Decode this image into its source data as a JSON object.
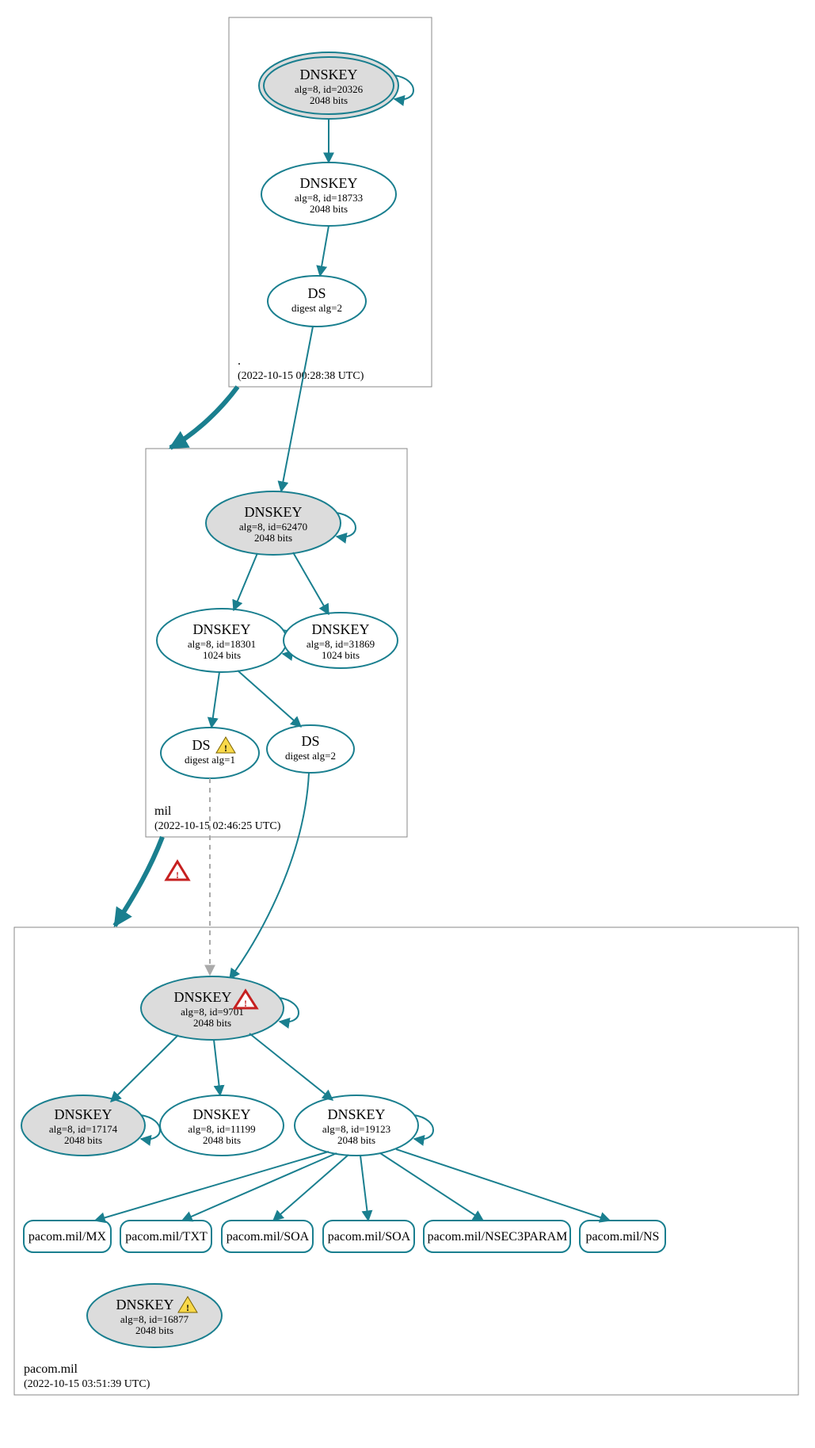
{
  "colors": {
    "stroke": "#1a7f8f",
    "fillGray": "#dcdcdc",
    "zoneBorder": "#888888"
  },
  "zones": {
    "root": {
      "label": ".",
      "timestamp": "(2022-10-15 00:28:38 UTC)"
    },
    "mil": {
      "label": "mil",
      "timestamp": "(2022-10-15 02:46:25 UTC)"
    },
    "pacom": {
      "label": "pacom.mil",
      "timestamp": "(2022-10-15 03:51:39 UTC)"
    }
  },
  "nodes": {
    "root_ksk": {
      "title": "DNSKEY",
      "line1": "alg=8, id=20326",
      "line2": "2048 bits"
    },
    "root_zsk": {
      "title": "DNSKEY",
      "line1": "alg=8, id=18733",
      "line2": "2048 bits"
    },
    "root_ds": {
      "title": "DS",
      "line1": "digest alg=2",
      "line2": ""
    },
    "mil_ksk": {
      "title": "DNSKEY",
      "line1": "alg=8, id=62470",
      "line2": "2048 bits"
    },
    "mil_zsk1": {
      "title": "DNSKEY",
      "line1": "alg=8, id=18301",
      "line2": "1024 bits"
    },
    "mil_zsk2": {
      "title": "DNSKEY",
      "line1": "alg=8, id=31869",
      "line2": "1024 bits"
    },
    "mil_ds1": {
      "title": "DS",
      "line1": "digest alg=1",
      "line2": ""
    },
    "mil_ds2": {
      "title": "DS",
      "line1": "digest alg=2",
      "line2": ""
    },
    "pac_ksk": {
      "title": "DNSKEY",
      "line1": "alg=8, id=9701",
      "line2": "2048 bits"
    },
    "pac_k2": {
      "title": "DNSKEY",
      "line1": "alg=8, id=17174",
      "line2": "2048 bits"
    },
    "pac_k3": {
      "title": "DNSKEY",
      "line1": "alg=8, id=11199",
      "line2": "2048 bits"
    },
    "pac_k4": {
      "title": "DNSKEY",
      "line1": "alg=8, id=19123",
      "line2": "2048 bits"
    },
    "pac_k5": {
      "title": "DNSKEY",
      "line1": "alg=8, id=16877",
      "line2": "2048 bits"
    }
  },
  "records": {
    "r1": "pacom.mil/MX",
    "r2": "pacom.mil/TXT",
    "r3": "pacom.mil/SOA",
    "r4": "pacom.mil/SOA",
    "r5": "pacom.mil/NSEC3PARAM",
    "r6": "pacom.mil/NS"
  }
}
